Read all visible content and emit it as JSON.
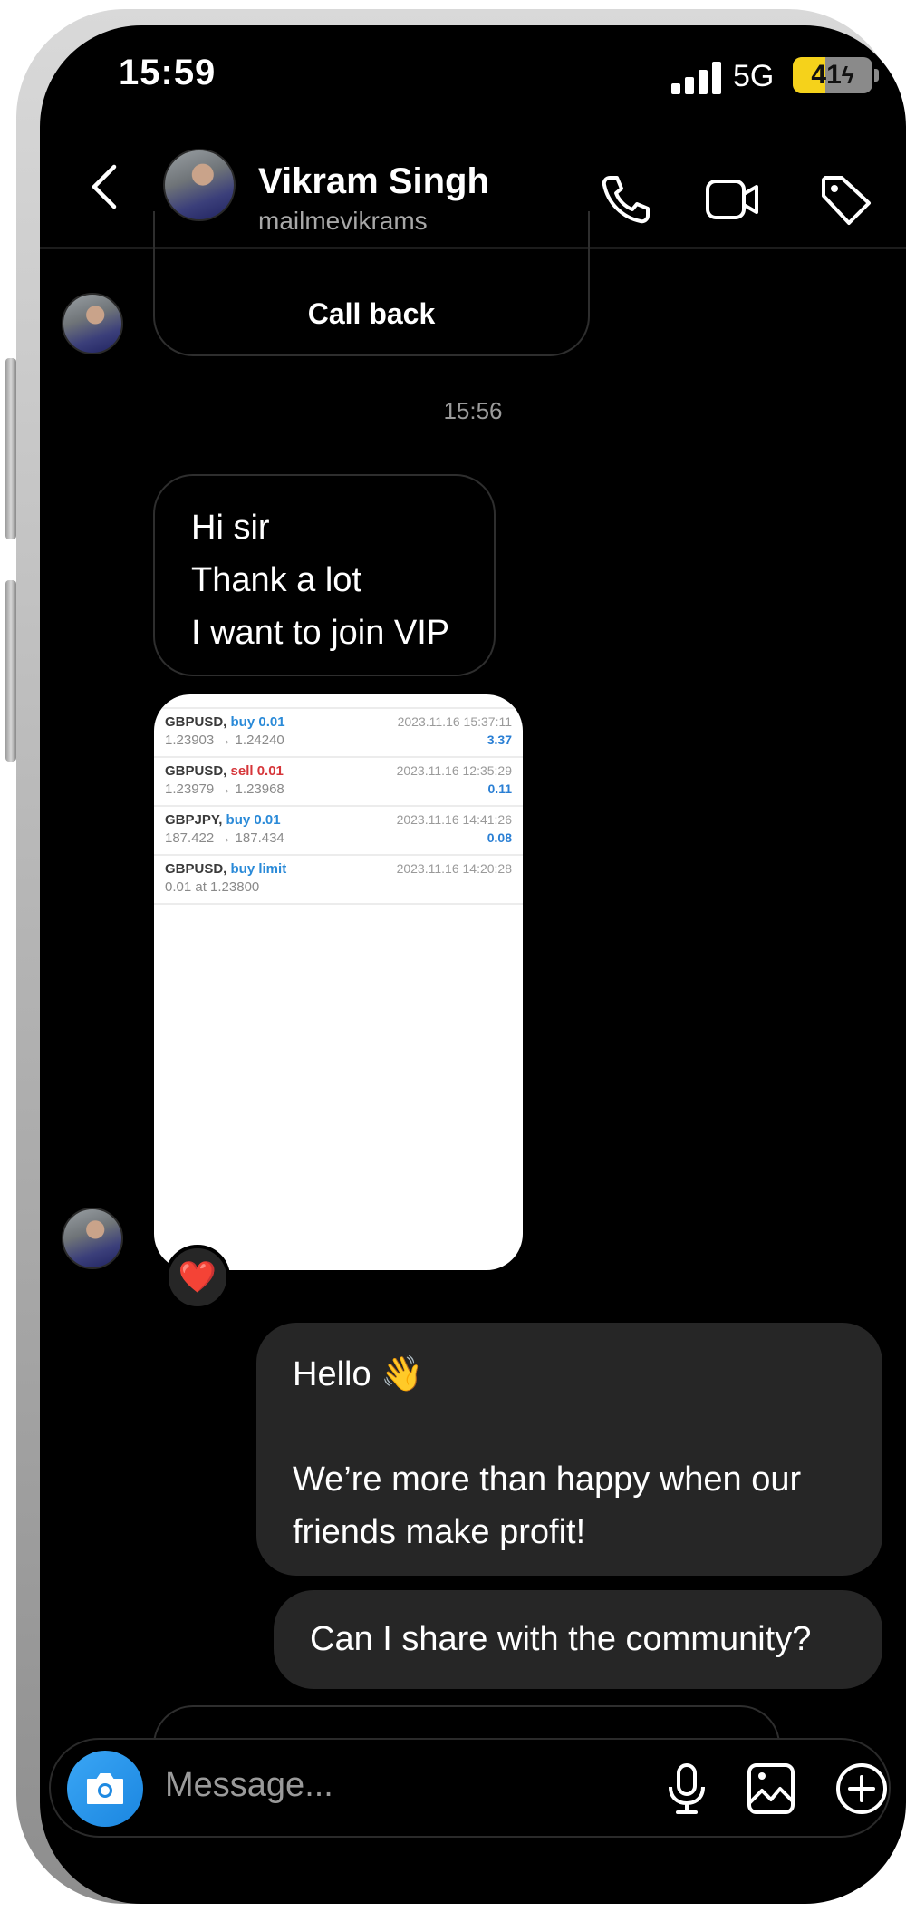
{
  "status_bar": {
    "time": "15:59",
    "network": "5G",
    "battery_label": "41",
    "battery_percent": 41,
    "battery_charging": true,
    "battery_color": "#f5d21b"
  },
  "header": {
    "contact_name": "Vikram Singh",
    "contact_handle": "mailmevikrams",
    "icons": [
      "back-chevron",
      "phone-call",
      "video-call",
      "tag"
    ]
  },
  "conversation": {
    "call_back_label": "Call back",
    "timestamp": "15:56",
    "incoming_message": {
      "lines": [
        "Hi sir",
        "Thank a lot",
        "I want to join VIP"
      ]
    },
    "trade_screenshot": {
      "rows": [
        {
          "symbol": "GBPUSD,",
          "action": "buy 0.01",
          "action_color": "#2a8ad8",
          "prices": "1.23903 → 1.24240",
          "datetime": "2023.11.16 15:37:11",
          "profit": "3.37"
        },
        {
          "symbol": "GBPUSD,",
          "action": "sell 0.01",
          "action_color": "#d6363a",
          "prices": "1.23979 → 1.23968",
          "datetime": "2023.11.16 12:35:29",
          "profit": "0.11"
        },
        {
          "symbol": "GBPJPY,",
          "action": "buy 0.01",
          "action_color": "#2a8ad8",
          "prices": "187.422 → 187.434",
          "datetime": "2023.11.16 14:41:26",
          "profit": "0.08"
        },
        {
          "symbol": "GBPUSD,",
          "action": "buy limit",
          "action_color": "#2a8ad8",
          "prices": "0.01 at 1.23800",
          "datetime": "2023.11.16 14:20:28",
          "profit": ""
        }
      ],
      "reaction": "❤️"
    },
    "outgoing_messages": [
      {
        "line1": "Hello 👋",
        "line2": "We’re more than happy when our",
        "line3": "friends make profit!"
      },
      {
        "text": "Can I share with the community?"
      }
    ]
  },
  "composer": {
    "placeholder": "Message...",
    "icons": [
      "camera",
      "microphone",
      "gallery",
      "plus-circle"
    ]
  }
}
